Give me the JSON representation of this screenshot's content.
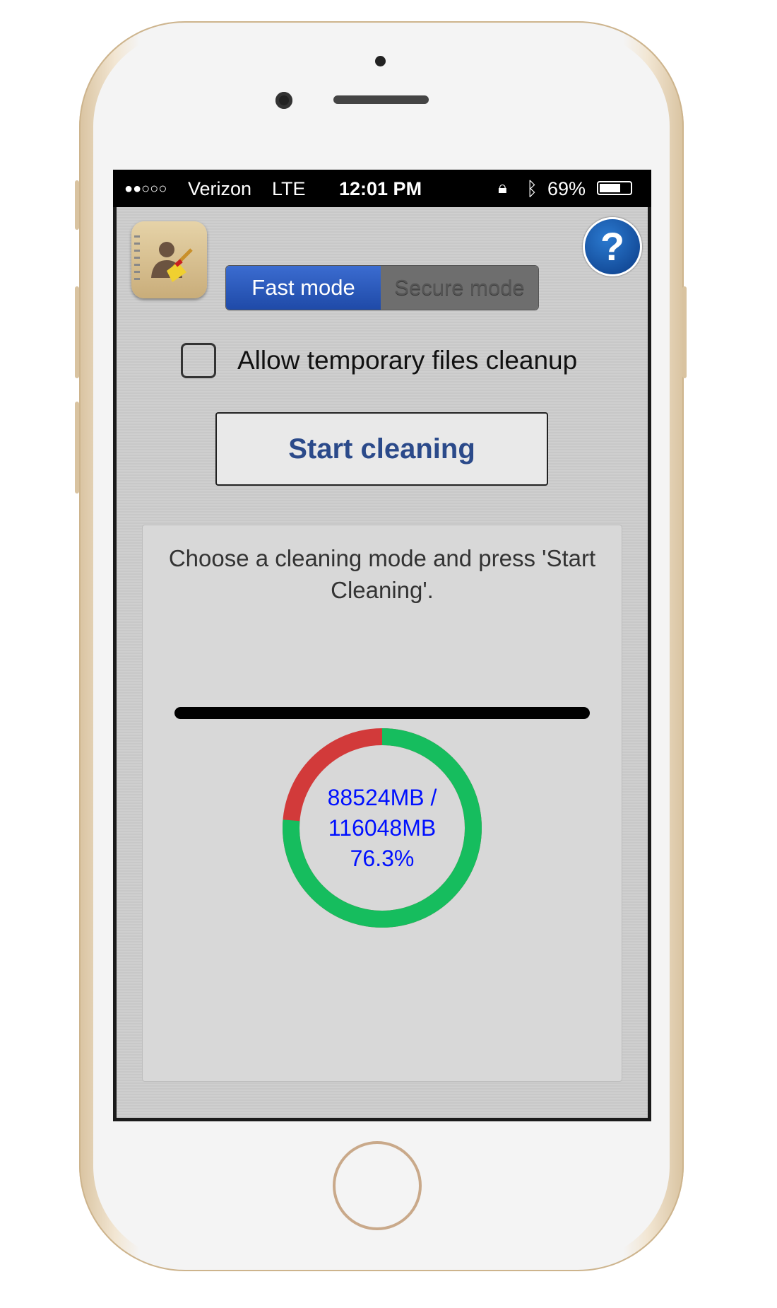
{
  "status_bar": {
    "signal": "●●○○○",
    "carrier": "Verizon",
    "network": "LTE",
    "time": "12:01 PM",
    "battery": "69%",
    "battery_level": 0.69
  },
  "header": {
    "app_icon": "contacts-broom-icon",
    "help_icon": "question-mark-icon",
    "help_glyph": "?"
  },
  "mode_selector": {
    "options": [
      "Fast mode",
      "Secure mode"
    ],
    "selected": "Fast mode"
  },
  "temp_files": {
    "label": "Allow temporary files cleanup",
    "checked": false
  },
  "start_button": {
    "label": "Start cleaning"
  },
  "panel": {
    "message": "Choose a cleaning mode and press 'Start Cleaning'.",
    "progress": 1.0,
    "storage": {
      "used_line": "88524MB /",
      "total_line": "116048MB",
      "percent_line": "76.3%",
      "percent": 76.3,
      "colors": {
        "used": "#16bd5e",
        "free": "#d23a3a"
      }
    }
  },
  "colors": {
    "accent": "#2b4a8a",
    "segment_selected": "#2a5bbf",
    "storage_text": "#0010ff"
  }
}
